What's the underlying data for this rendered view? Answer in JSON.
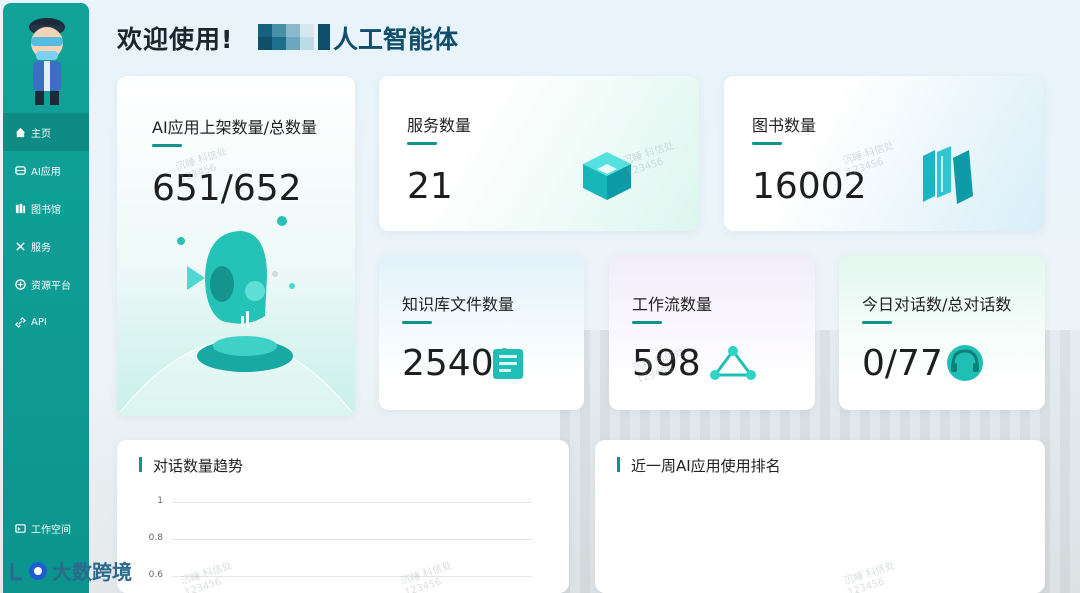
{
  "header": {
    "welcome": "欢迎使用!",
    "brand": "人工智能体"
  },
  "sidebar": {
    "items": [
      {
        "label": "主页",
        "icon": "home-icon"
      },
      {
        "label": "AI应用",
        "icon": "app-icon"
      },
      {
        "label": "图书馆",
        "icon": "library-icon"
      },
      {
        "label": "服务",
        "icon": "service-icon"
      },
      {
        "label": "资源平台",
        "icon": "resource-icon"
      },
      {
        "label": "API",
        "icon": "api-icon"
      }
    ],
    "bottom_item": {
      "label": "工作空间",
      "icon": "terminal-icon"
    }
  },
  "cards": {
    "ai_apps": {
      "label": "AI应用上架数量/总数量",
      "value": "651/652"
    },
    "services": {
      "label": "服务数量",
      "value": "21"
    },
    "books": {
      "label": "图书数量",
      "value": "16002"
    },
    "kb_files": {
      "label": "知识库文件数量",
      "value": "25409"
    },
    "workflows": {
      "label": "工作流数量",
      "value": "598"
    },
    "dialogs": {
      "label": "今日对话数/总对话数",
      "value": "0/77"
    }
  },
  "panels": {
    "trend": {
      "title": "对话数量趋势",
      "y_ticks": [
        "1",
        "0.8",
        "0.6"
      ]
    },
    "ranking": {
      "title": "近一周AI应用使用排名"
    }
  },
  "watermark": {
    "line1": "沉睡 科信处",
    "line2": "123456"
  },
  "footer": {
    "logo_text": "大数跨境"
  },
  "colors": {
    "accent": "#10928d",
    "sidebar": "#11a39a",
    "brand": "#0f4f6b"
  }
}
